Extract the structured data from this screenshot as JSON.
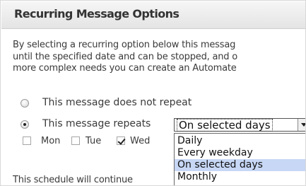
{
  "panel": {
    "title": "Recurring Message Options"
  },
  "description": {
    "line1": "By selecting a recurring option below this messag",
    "line2": "until the specified date and can be stopped, and o",
    "line3": "more complex needs you can create an Automate"
  },
  "options": {
    "no_repeat_label": "This message does not repeat",
    "repeat_label": "This message repeats"
  },
  "repeat_select": {
    "selected_value": "On selected days",
    "options": [
      "Daily",
      "Every weekday",
      "On selected days",
      "Monthly"
    ],
    "highlighted_index": 2
  },
  "days": [
    {
      "label": "Mon",
      "checked": false
    },
    {
      "label": "Tue",
      "checked": false
    },
    {
      "label": "Wed",
      "checked": true
    }
  ],
  "footer": {
    "text": "This schedule will continue"
  }
}
